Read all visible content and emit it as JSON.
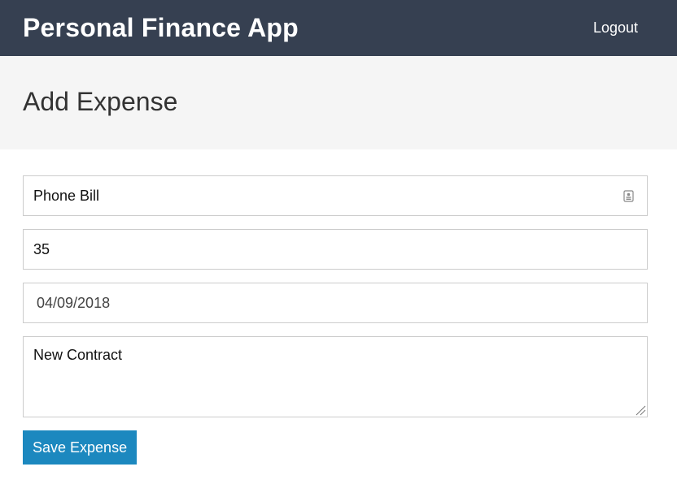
{
  "header": {
    "app_title": "Personal Finance App",
    "logout_label": "Logout"
  },
  "page": {
    "title": "Add Expense"
  },
  "form": {
    "description": {
      "value": "Phone Bill",
      "icon": "contact-card-icon"
    },
    "amount": {
      "value": "35"
    },
    "date": {
      "value": "04/09/2018"
    },
    "note": {
      "value": "New Contract"
    },
    "save_label": "Save Expense"
  },
  "colors": {
    "header_bg": "#364051",
    "page_head_bg": "#f5f5f5",
    "button_bg": "#1c88bf"
  }
}
